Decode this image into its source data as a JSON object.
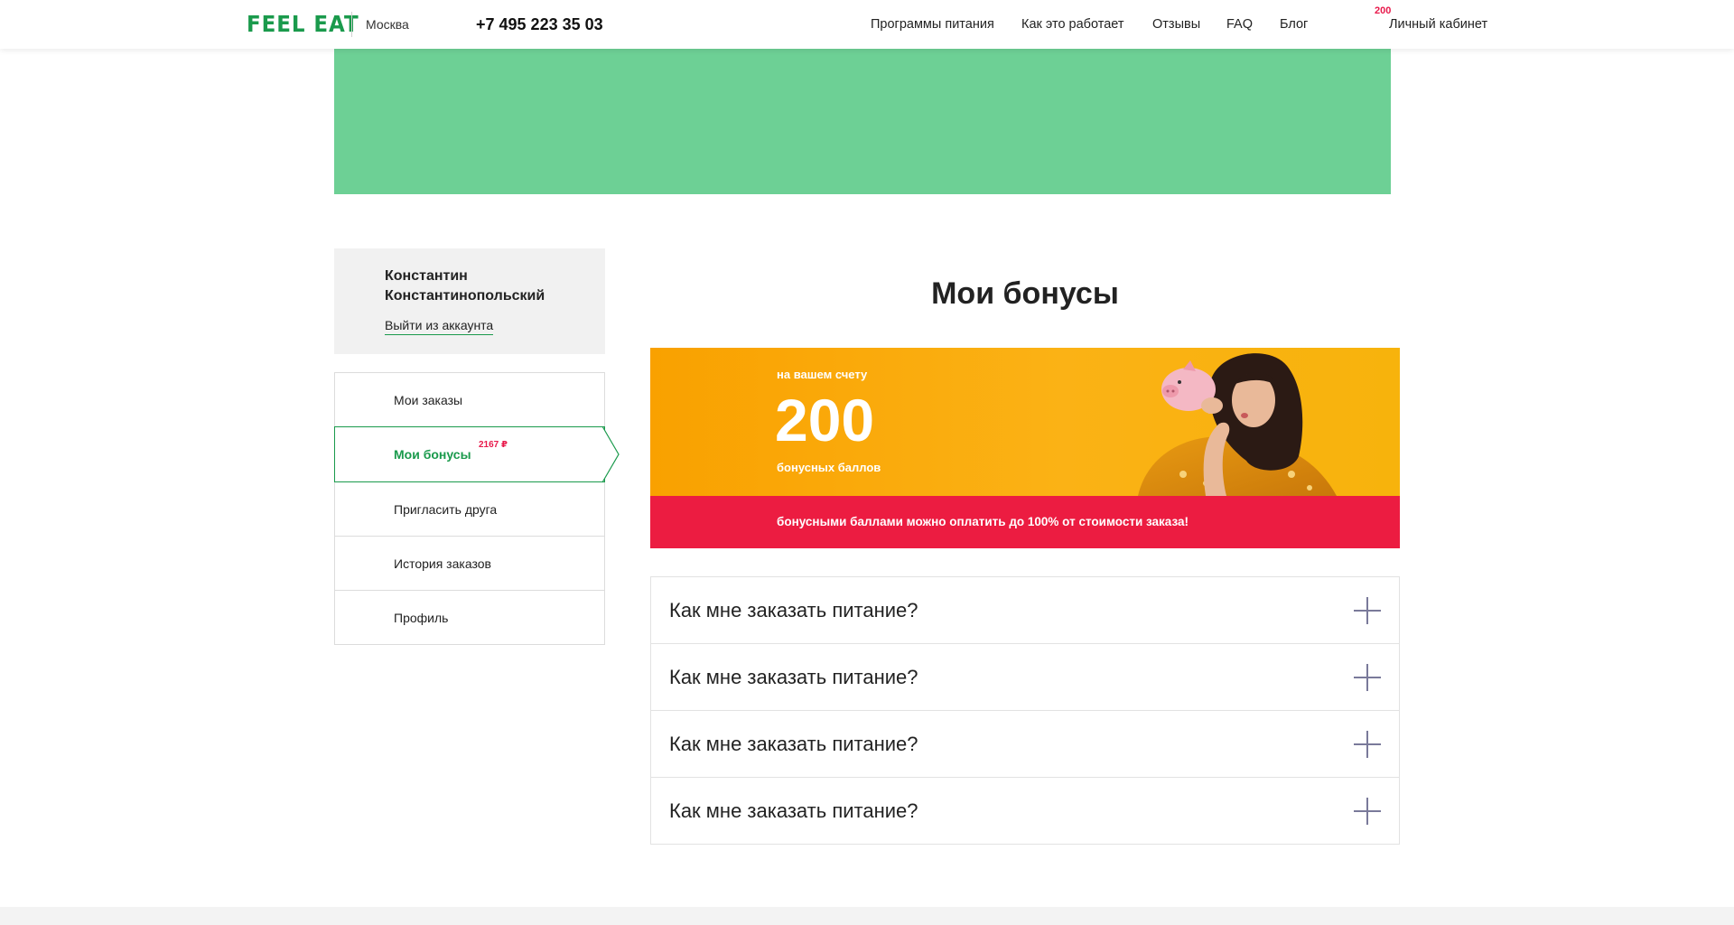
{
  "header": {
    "logo": "FEEL EAT",
    "city": "Москва",
    "phone": "+7 495 223 35 03",
    "nav": [
      {
        "label": "Программы питания"
      },
      {
        "label": "Как это работает"
      },
      {
        "label": "Отзывы"
      },
      {
        "label": "FAQ"
      },
      {
        "label": "Блог"
      },
      {
        "label": "Личный кабинет",
        "badge": "200"
      }
    ]
  },
  "banner": {
    "color": "#6dd095"
  },
  "user": {
    "name": "Константин Константинопольский",
    "logout": "Выйти из аккаунта"
  },
  "menu": {
    "items": [
      {
        "label": "Мои заказы"
      },
      {
        "label": "Мои бонусы",
        "sup": "2167 ₽",
        "active": true
      },
      {
        "label": "Пригласить друга"
      },
      {
        "label": "История заказов"
      },
      {
        "label": "Профиль"
      }
    ]
  },
  "main": {
    "title": "Мои бонусы",
    "bonus": {
      "caption": "на вашем счету",
      "amount": "200",
      "unit": "бонусных баллов",
      "note": "бонусными баллами можно оплатить до 100% от стоимости заказа!"
    },
    "faq": [
      {
        "question": "Как мне заказать питание?"
      },
      {
        "question": "Как мне заказать питание?"
      },
      {
        "question": "Как мне заказать питание?"
      },
      {
        "question": "Как мне заказать питание?"
      }
    ]
  },
  "colors": {
    "brand_green": "#1a9a4c",
    "banner_green": "#6dd095",
    "accent_red": "#ec1c41",
    "bonus_orange": "#f9a100"
  }
}
